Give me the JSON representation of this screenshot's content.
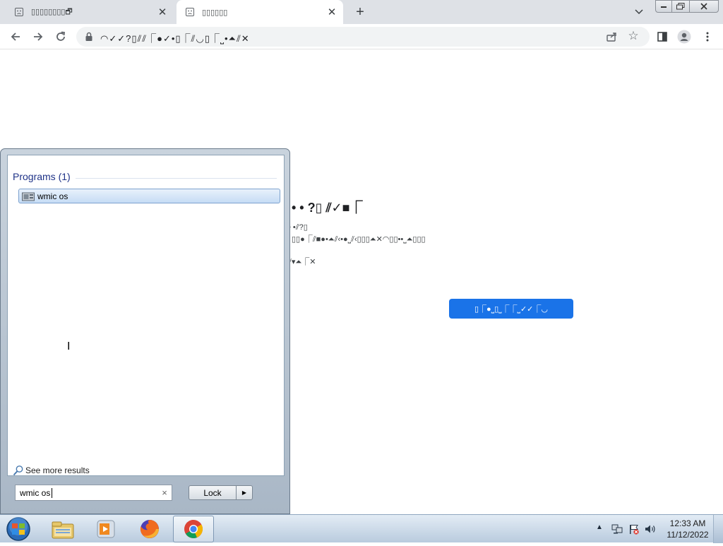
{
  "browser": {
    "tabs": [
      {
        "title": "▯▯▯▯▯▯▯▯🗗",
        "active": false,
        "icon": "sad-face-icon"
      },
      {
        "title": "▯▯▯▯▯▯",
        "active": true,
        "icon": "sad-face-icon"
      }
    ],
    "url": "◠✓✓?▯⫽⫽⎾●✓•▯⎾⫽◡▯⎾⎵•⏶⫽✕"
  },
  "page": {
    "heading": "• • ?▯ ⫽✓■⎾",
    "sub1": "• •⫽?▯",
    "sub2": "▯▯●⎾⫽■●•⏶⫽‹•●⎵⫽‹▯▯▯⏶✕◠▯▯••⎵⏶▯▯▯",
    "sub3": "⫽▾⏶⎾✕",
    "button_label": "▯⎾●⎵▯⎵⎾⎾⎵✓✓⎾◡"
  },
  "start_menu": {
    "programs_header": "Programs (1)",
    "result_label": "wmic os",
    "see_more_label": "See more results",
    "search_value": "wmic os",
    "clear_symbol": "×",
    "lock_label": "Lock",
    "lock_arrow": "▶"
  },
  "taskbar": {
    "apps": [
      "start-orb",
      "windows-explorer",
      "media-player",
      "firefox",
      "chrome"
    ],
    "tray_arrow": "▲",
    "time": "12:33 AM",
    "date": "11/12/2022"
  },
  "colors": {
    "accent_button": "#1a73e8",
    "tabstrip": "#dee1e6",
    "programs_header": "#1e3287"
  }
}
